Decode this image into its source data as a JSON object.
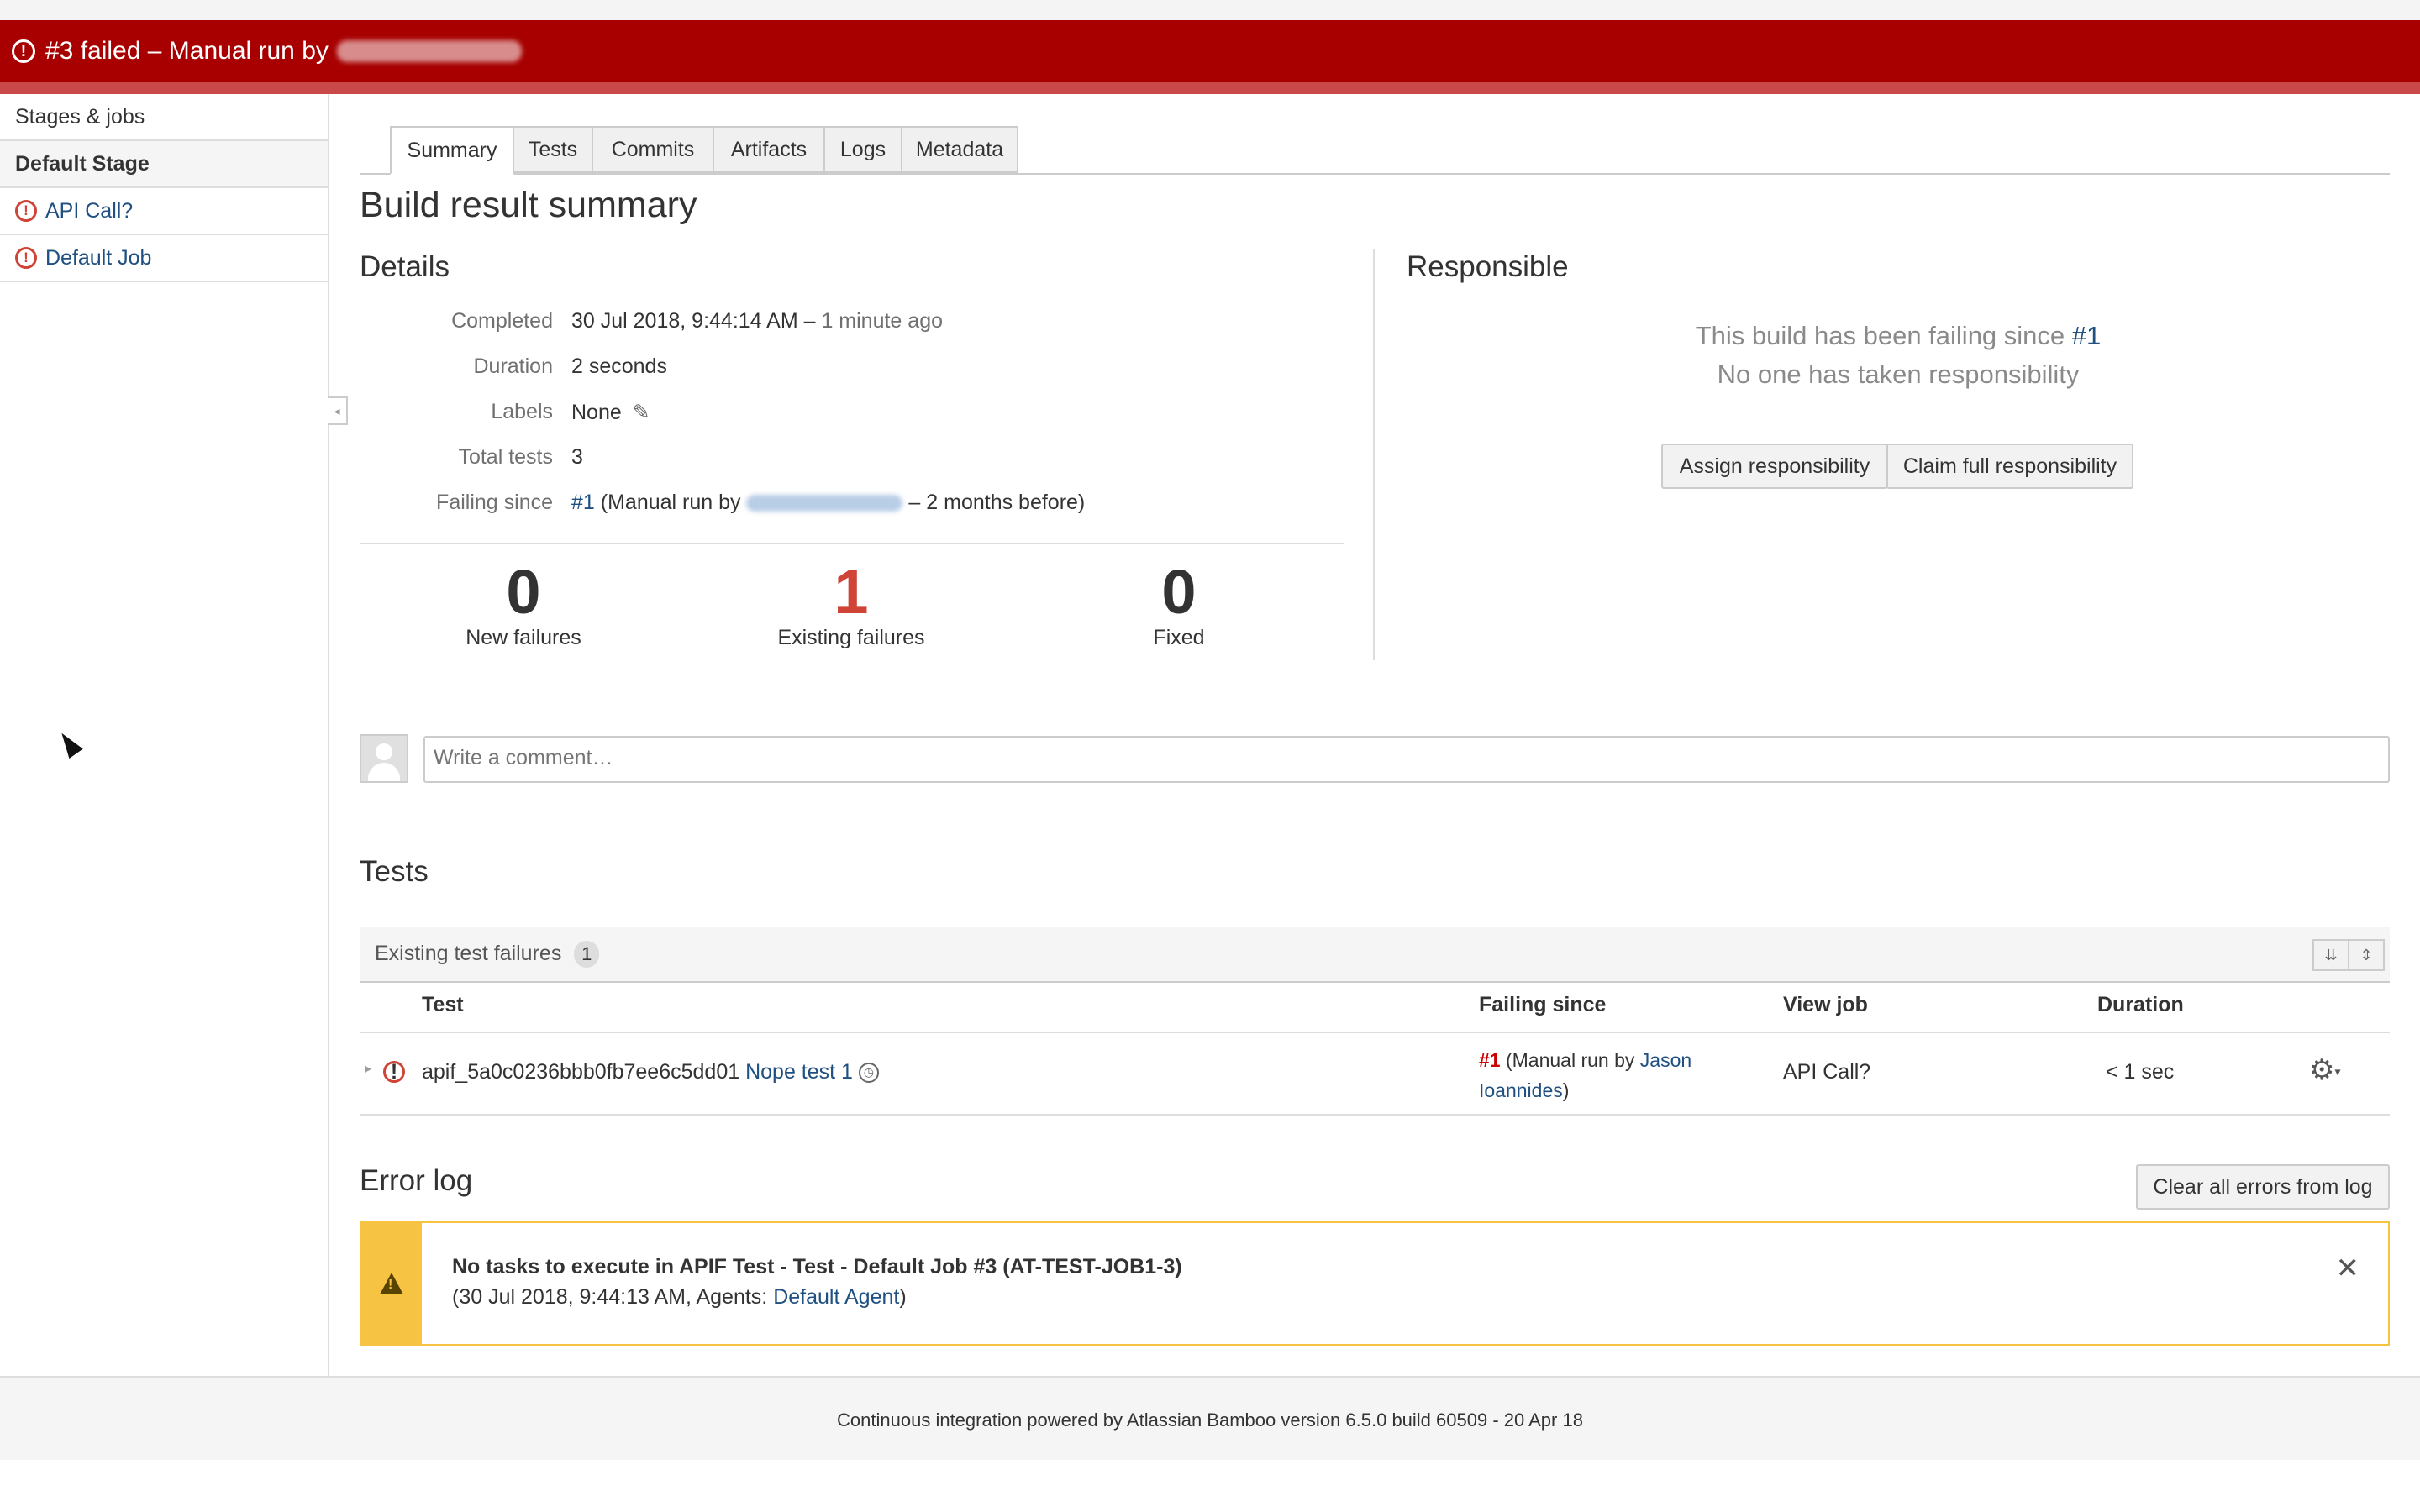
{
  "banner": {
    "title": "#3 failed – Manual run by"
  },
  "sidebar": {
    "header": "Stages & jobs",
    "stage": "Default Stage",
    "jobs": [
      {
        "label": "API Call?"
      },
      {
        "label": "Default Job"
      }
    ]
  },
  "tabs": [
    "Summary",
    "Tests",
    "Commits",
    "Artifacts",
    "Logs",
    "Metadata"
  ],
  "page_title": "Build result summary",
  "details": {
    "heading": "Details",
    "completed_label": "Completed",
    "completed_value": "30 Jul 2018, 9:44:14 AM –",
    "completed_ago": "1 minute ago",
    "duration_label": "Duration",
    "duration_value": "2 seconds",
    "labels_label": "Labels",
    "labels_value": "None",
    "total_tests_label": "Total tests",
    "total_tests_value": "3",
    "failing_since_label": "Failing since",
    "failing_since_link": "#1",
    "failing_since_text": "(Manual run by",
    "failing_since_tail": "– 2 months before)"
  },
  "stats": [
    {
      "num": "0",
      "caption": "New failures"
    },
    {
      "num": "1",
      "caption": "Existing failures"
    },
    {
      "num": "0",
      "caption": "Fixed"
    }
  ],
  "responsible": {
    "heading": "Responsible",
    "line1": "This build has been failing since",
    "line1_link": "#1",
    "line2": "No one has taken responsibility",
    "assign_button": "Assign responsibility",
    "claim_button": "Claim full responsibility"
  },
  "comment": {
    "placeholder": "Write a comment…"
  },
  "tests": {
    "heading": "Tests",
    "group_title": "Existing test failures",
    "group_count": "1",
    "columns": {
      "test": "Test",
      "failing_since": "Failing since",
      "view_job": "View job",
      "duration": "Duration"
    },
    "rows": [
      {
        "test_class": "apif_5a0c0236bbb0fb7ee6c5dd01",
        "test_name": "Nope test 1",
        "failing_since_link": "#1",
        "failing_since_text": "(Manual run by",
        "failing_since_user1": "Jason",
        "failing_since_user2": "Ioannides",
        "failing_since_close": ")",
        "job": "API Call?",
        "duration": "< 1 sec"
      }
    ]
  },
  "error_log": {
    "heading": "Error log",
    "clear_button": "Clear all errors from log",
    "message_title": "No tasks to execute in APIF Test - Test - Default Job #3 (AT-TEST-JOB1-3)",
    "message_prefix": "(30 Jul 2018, 9:44:13 AM, Agents:",
    "agent_link": "Default Agent",
    "message_suffix": ")"
  },
  "footer": {
    "text": "Continuous integration powered by Atlassian Bamboo version 6.5.0 build 60509 - 20 Apr 18"
  },
  "colors": {
    "banner": "#a80000",
    "error": "#d04437",
    "link": "#205081",
    "warning": "#f6c342"
  },
  "icons": {
    "error": "exclamation-circle-icon",
    "warning": "warning-triangle-icon",
    "settings": "gear-icon",
    "history": "clock-icon",
    "close": "close-icon",
    "edit": "pencil-icon"
  }
}
